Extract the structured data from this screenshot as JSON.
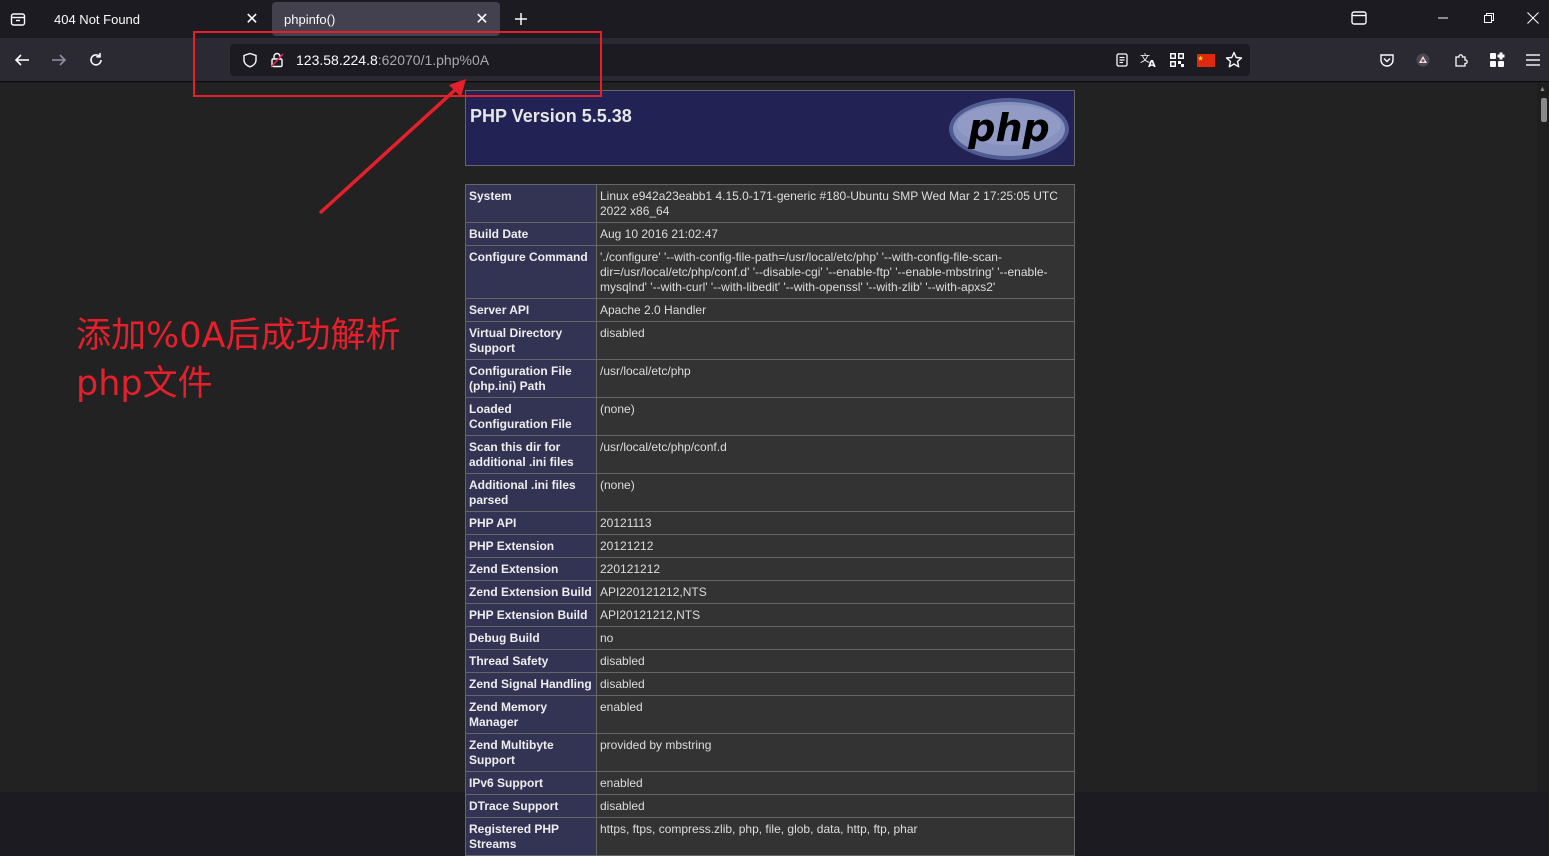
{
  "browser": {
    "tabs": [
      {
        "title": "404 Not Found",
        "active": false
      },
      {
        "title": "phpinfo()",
        "active": true
      }
    ],
    "url": {
      "host": "123.58.224.8",
      "rest": ":62070/1.php%0A"
    }
  },
  "annotation": {
    "line1": "添加%0A后成功解析",
    "line2": "php文件",
    "color": "#e5202c"
  },
  "phpinfo": {
    "version_title": "PHP Version 5.5.38",
    "logo_text": "php",
    "rows": [
      {
        "key": "System",
        "value": "Linux e942a23eabb1 4.15.0-171-generic #180-Ubuntu SMP Wed Mar 2 17:25:05 UTC 2022 x86_64"
      },
      {
        "key": "Build Date",
        "value": "Aug 10 2016 21:02:47"
      },
      {
        "key": "Configure Command",
        "value": "'./configure' '--with-config-file-path=/usr/local/etc/php' '--with-config-file-scan-dir=/usr/local/etc/php/conf.d' '--disable-cgi' '--enable-ftp' '--enable-mbstring' '--enable-mysqlnd' '--with-curl' '--with-libedit' '--with-openssl' '--with-zlib' '--with-apxs2'"
      },
      {
        "key": "Server API",
        "value": "Apache 2.0 Handler"
      },
      {
        "key": "Virtual Directory Support",
        "value": "disabled"
      },
      {
        "key": "Configuration File (php.ini) Path",
        "value": "/usr/local/etc/php"
      },
      {
        "key": "Loaded Configuration File",
        "value": "(none)"
      },
      {
        "key": "Scan this dir for additional .ini files",
        "value": "/usr/local/etc/php/conf.d"
      },
      {
        "key": "Additional .ini files parsed",
        "value": "(none)"
      },
      {
        "key": "PHP API",
        "value": "20121113"
      },
      {
        "key": "PHP Extension",
        "value": "20121212"
      },
      {
        "key": "Zend Extension",
        "value": "220121212"
      },
      {
        "key": "Zend Extension Build",
        "value": "API220121212,NTS"
      },
      {
        "key": "PHP Extension Build",
        "value": "API20121212,NTS"
      },
      {
        "key": "Debug Build",
        "value": "no"
      },
      {
        "key": "Thread Safety",
        "value": "disabled"
      },
      {
        "key": "Zend Signal Handling",
        "value": "disabled"
      },
      {
        "key": "Zend Memory Manager",
        "value": "enabled"
      },
      {
        "key": "Zend Multibyte Support",
        "value": "provided by mbstring"
      },
      {
        "key": "IPv6 Support",
        "value": "enabled"
      },
      {
        "key": "DTrace Support",
        "value": "disabled"
      },
      {
        "key": "Registered PHP Streams",
        "value": "https, ftps, compress.zlib, php, file, glob, data, http, ftp, phar"
      }
    ]
  }
}
